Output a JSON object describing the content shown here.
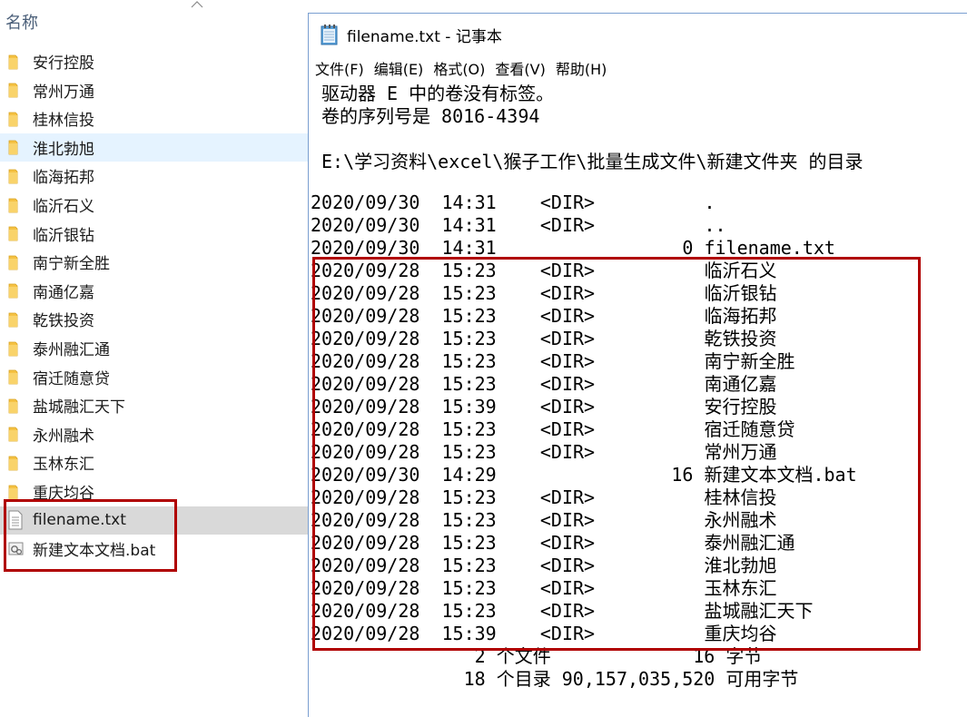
{
  "explorer": {
    "column_header": "名称",
    "items": [
      {
        "label": "安行控股",
        "type": "folder"
      },
      {
        "label": "常州万通",
        "type": "folder"
      },
      {
        "label": "桂林信投",
        "type": "folder"
      },
      {
        "label": "淮北勃旭",
        "type": "folder",
        "state": "hover"
      },
      {
        "label": "临海拓邦",
        "type": "folder"
      },
      {
        "label": "临沂石义",
        "type": "folder"
      },
      {
        "label": "临沂银钻",
        "type": "folder"
      },
      {
        "label": "南宁新全胜",
        "type": "folder"
      },
      {
        "label": "南通亿嘉",
        "type": "folder"
      },
      {
        "label": "乾铁投资",
        "type": "folder"
      },
      {
        "label": "泰州融汇通",
        "type": "folder"
      },
      {
        "label": "宿迁随意贷",
        "type": "folder"
      },
      {
        "label": "盐城融汇天下",
        "type": "folder"
      },
      {
        "label": "永州融术",
        "type": "folder"
      },
      {
        "label": "玉林东汇",
        "type": "folder"
      },
      {
        "label": "重庆均谷",
        "type": "folder"
      },
      {
        "label": "filename.txt",
        "type": "text-file",
        "state": "selected"
      },
      {
        "label": "新建文本文档.bat",
        "type": "bat-file"
      }
    ]
  },
  "notepad": {
    "title": "filename.txt - 记事本",
    "menus": [
      "文件(F)",
      "编辑(E)",
      "格式(O)",
      "查看(V)",
      "帮助(H)"
    ],
    "header_lines": [
      "驱动器 E 中的卷没有标签。",
      "卷的序列号是 8016-4394",
      "",
      "E:\\学习资料\\excel\\猴子工作\\批量生成文件\\新建文件夹 的目录"
    ],
    "dir_lines": [
      "2020/09/30  14:31    <DIR>          .",
      "2020/09/30  14:31    <DIR>          ..",
      "2020/09/30  14:31                 0 filename.txt",
      "2020/09/28  15:23    <DIR>          临沂石义",
      "2020/09/28  15:23    <DIR>          临沂银钻",
      "2020/09/28  15:23    <DIR>          临海拓邦",
      "2020/09/28  15:23    <DIR>          乾铁投资",
      "2020/09/28  15:23    <DIR>          南宁新全胜",
      "2020/09/28  15:23    <DIR>          南通亿嘉",
      "2020/09/28  15:39    <DIR>          安行控股",
      "2020/09/28  15:23    <DIR>          宿迁随意贷",
      "2020/09/28  15:23    <DIR>          常州万通",
      "2020/09/30  14:29                16 新建文本文档.bat",
      "2020/09/28  15:23    <DIR>          桂林信投",
      "2020/09/28  15:23    <DIR>          永州融术",
      "2020/09/28  15:23    <DIR>          泰州融汇通",
      "2020/09/28  15:23    <DIR>          淮北勃旭",
      "2020/09/28  15:23    <DIR>          玉林东汇",
      "2020/09/28  15:23    <DIR>          盐城融汇天下",
      "2020/09/28  15:39    <DIR>          重庆均谷"
    ],
    "summary_lines": [
      "               2 个文件             16 字节",
      "              18 个目录 90,157,035,520 可用字节"
    ]
  },
  "colors": {
    "highlight_box": "#b00000",
    "folder_yellow": "#f5c244",
    "hover_bg": "#e5f3ff",
    "selected_bg": "#d9d9d9"
  }
}
